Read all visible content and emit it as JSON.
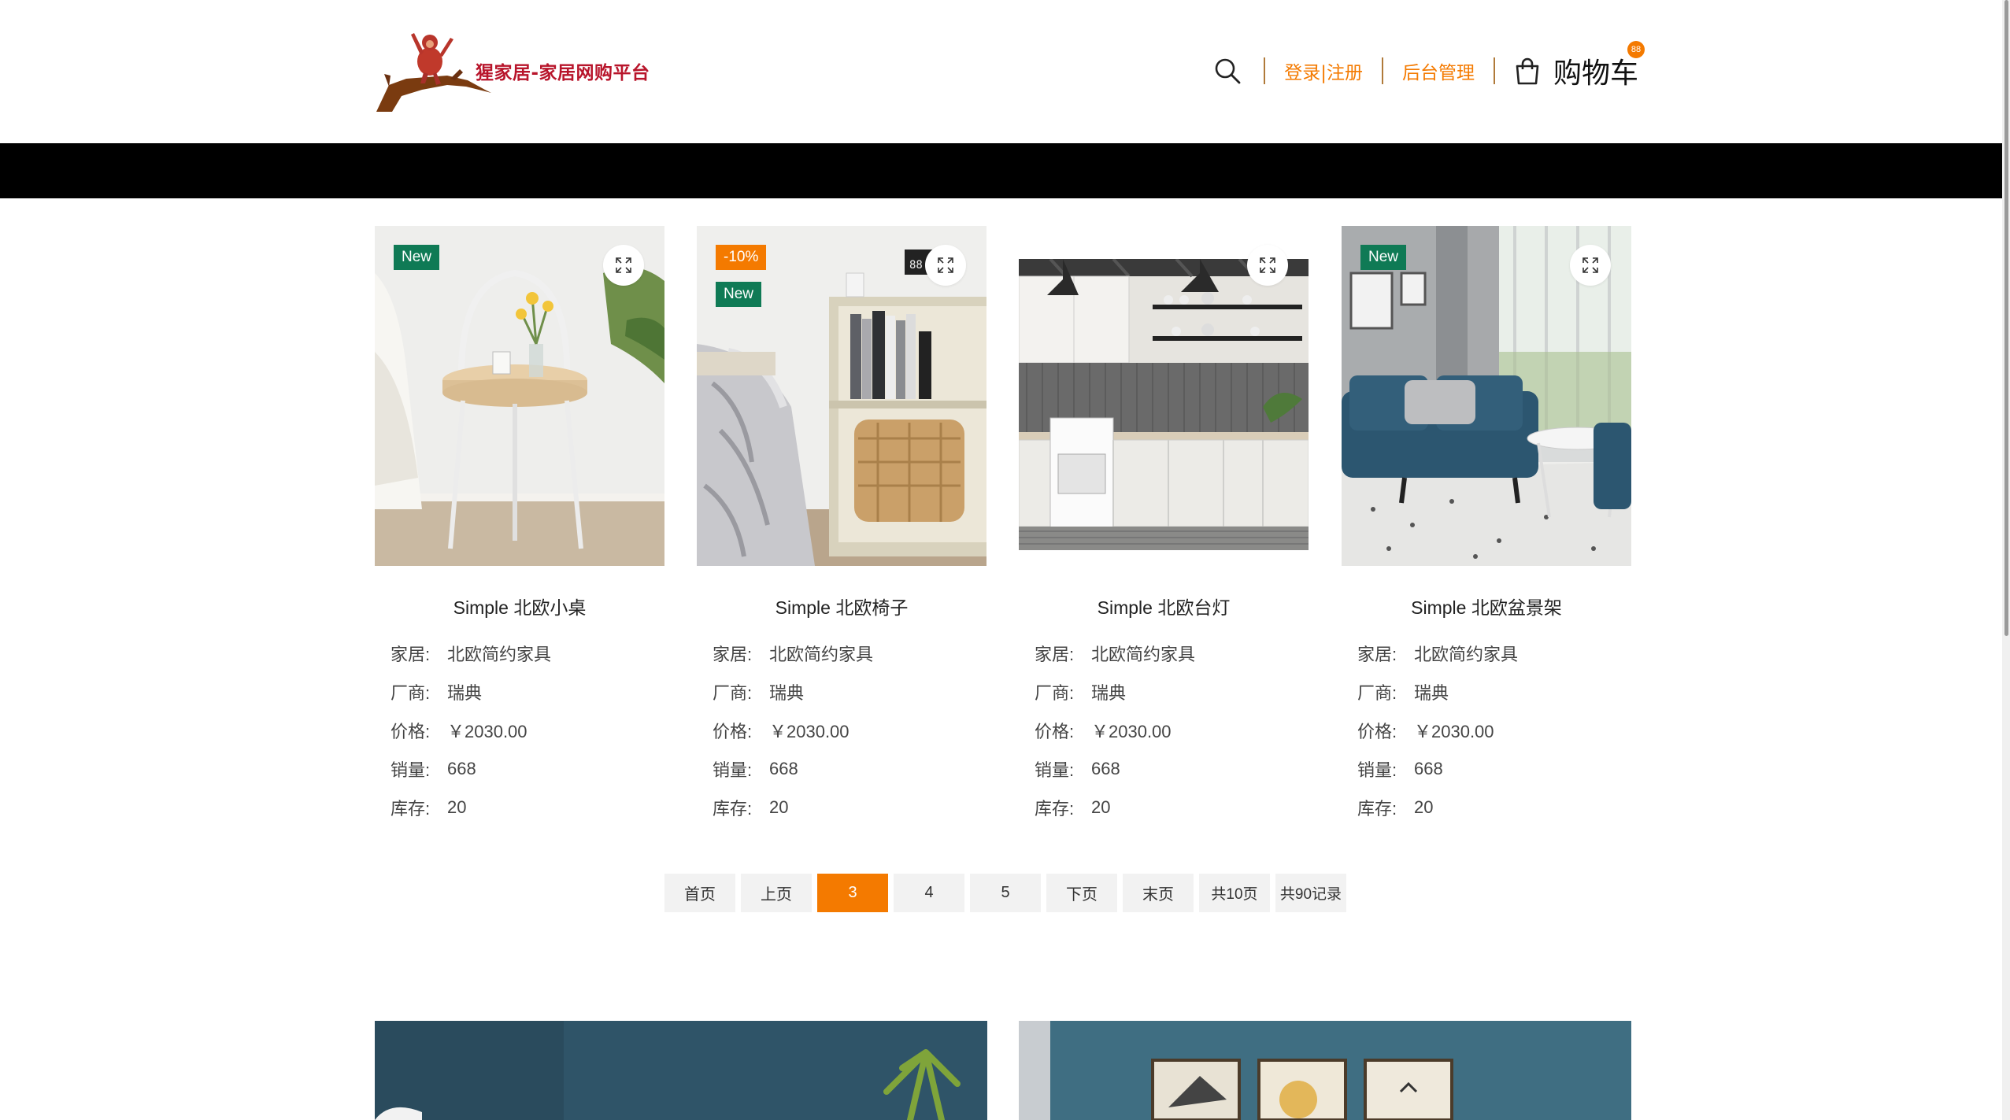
{
  "header": {
    "site_name": "猩家居-家居网购平台",
    "nav": {
      "login_register": "登录|注册",
      "admin": "后台管理",
      "cart_label": "购物车",
      "cart_count": "88"
    }
  },
  "products": [
    {
      "title": "Simple 北欧小桌",
      "badges": [
        "New"
      ],
      "attrs": [
        {
          "k": "家居:",
          "v": "北欧简约家具"
        },
        {
          "k": "厂商:",
          "v": "瑞典"
        },
        {
          "k": "价格:",
          "v": "￥2030.00"
        },
        {
          "k": "销量:",
          "v": "668"
        },
        {
          "k": "库存:",
          "v": "20"
        }
      ]
    },
    {
      "title": "Simple 北欧椅子",
      "badges": [
        "-10%",
        "New"
      ],
      "attrs": [
        {
          "k": "家居:",
          "v": "北欧简约家具"
        },
        {
          "k": "厂商:",
          "v": "瑞典"
        },
        {
          "k": "价格:",
          "v": "￥2030.00"
        },
        {
          "k": "销量:",
          "v": "668"
        },
        {
          "k": "库存:",
          "v": "20"
        }
      ]
    },
    {
      "title": "Simple 北欧台灯",
      "badges": [],
      "attrs": [
        {
          "k": "家居:",
          "v": "北欧简约家具"
        },
        {
          "k": "厂商:",
          "v": "瑞典"
        },
        {
          "k": "价格:",
          "v": "￥2030.00"
        },
        {
          "k": "销量:",
          "v": "668"
        },
        {
          "k": "库存:",
          "v": "20"
        }
      ]
    },
    {
      "title": "Simple 北欧盆景架",
      "badges": [
        "New"
      ],
      "attrs": [
        {
          "k": "家居:",
          "v": "北欧简约家具"
        },
        {
          "k": "厂商:",
          "v": "瑞典"
        },
        {
          "k": "价格:",
          "v": "￥2030.00"
        },
        {
          "k": "销量:",
          "v": "668"
        },
        {
          "k": "库存:",
          "v": "20"
        }
      ]
    }
  ],
  "pagination": {
    "first": "首页",
    "prev": "上页",
    "pages": [
      "3",
      "4",
      "5"
    ],
    "current": "3",
    "next": "下页",
    "last": "末页",
    "total_pages": "共10页",
    "total_records": "共90记录"
  },
  "colors": {
    "accent": "#f47a00",
    "new_badge": "#0f7a55",
    "brand_text": "#b8152b"
  },
  "icons": {
    "search": "search-icon",
    "cart": "shopping-bag-icon",
    "zoom": "expand-icon"
  }
}
